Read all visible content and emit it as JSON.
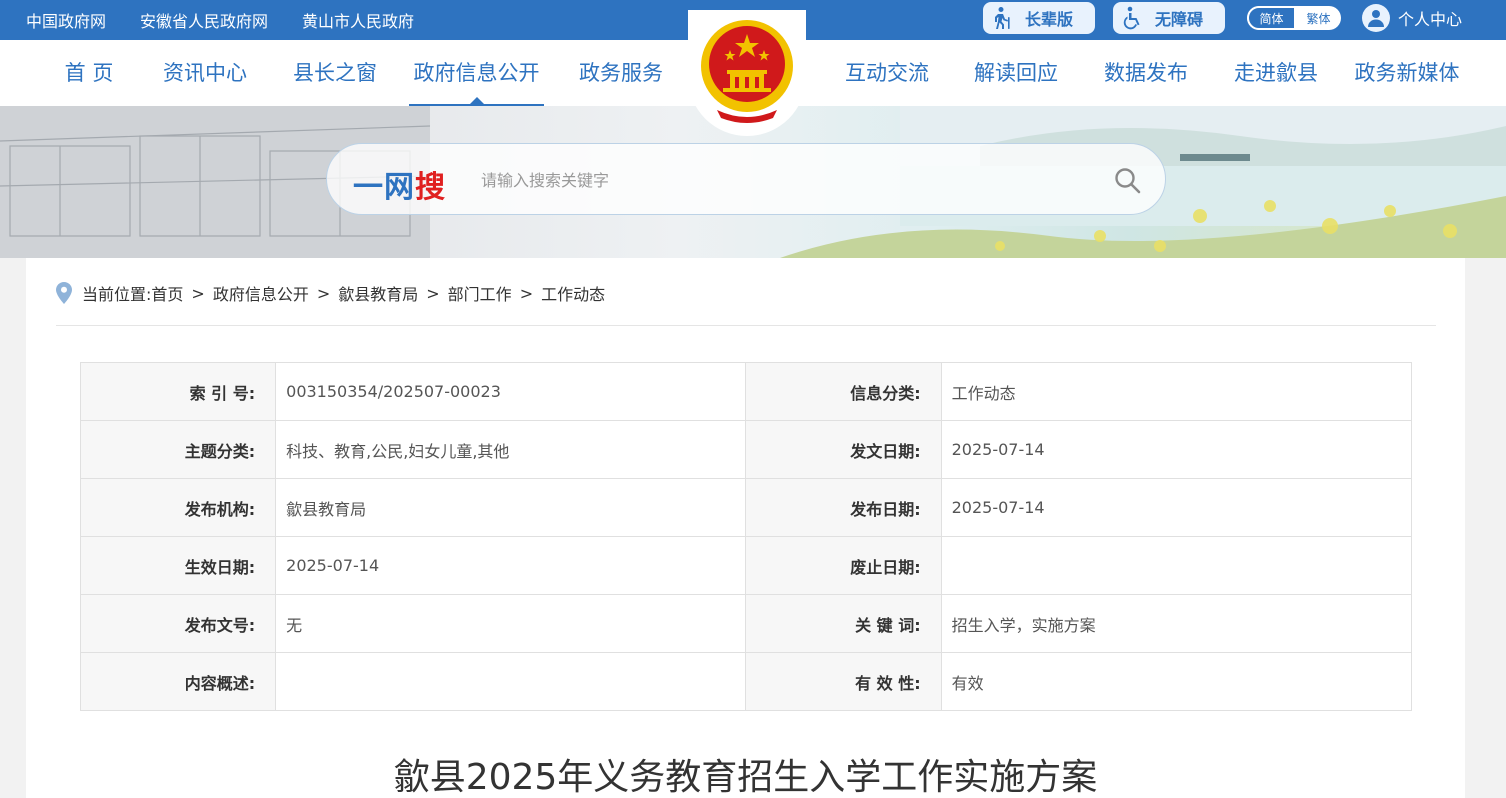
{
  "topbar": {
    "links": [
      "中国政府网",
      "安徽省人民政府网",
      "黄山市人民政府"
    ],
    "elder_label": "长辈版",
    "access_label": "无障碍",
    "lang_simplified": "简体",
    "lang_traditional": "繁体",
    "user_label": "个人中心"
  },
  "nav": {
    "items": [
      "首 页",
      "资讯中心",
      "县长之窗",
      "政府信息公开",
      "政务服务",
      "互动交流",
      "解读回应",
      "数据发布",
      "走进歙县",
      "政务新媒体"
    ],
    "active": "政府信息公开"
  },
  "search": {
    "logo_part1": "一网",
    "logo_part2": "搜",
    "placeholder": "请输入搜索关键字"
  },
  "breadcrumb": {
    "prefix": "当前位置:",
    "items": [
      "首页",
      "政府信息公开",
      "歙县教育局",
      "部门工作",
      "工作动态"
    ]
  },
  "meta": {
    "rows": [
      [
        {
          "label": "索 引 号:",
          "value": "003150354/202507-00023"
        },
        {
          "label": "信息分类:",
          "value": "工作动态"
        }
      ],
      [
        {
          "label": "主题分类:",
          "value": "科技、教育,公民,妇女儿童,其他"
        },
        {
          "label": "发文日期:",
          "value": "2025-07-14"
        }
      ],
      [
        {
          "label": "发布机构:",
          "value": "歙县教育局"
        },
        {
          "label": "发布日期:",
          "value": "2025-07-14"
        }
      ],
      [
        {
          "label": "生效日期:",
          "value": "2025-07-14"
        },
        {
          "label": "废止日期:",
          "value": ""
        }
      ],
      [
        {
          "label": "发布文号:",
          "value": "无"
        },
        {
          "label": "关 键 词:",
          "value": "招生入学，实施方案"
        }
      ],
      [
        {
          "label": "内容概述:",
          "value": ""
        },
        {
          "label": "有 效 性:",
          "value": "有效"
        }
      ]
    ]
  },
  "article": {
    "title": "歙县2025年义务教育招生入学工作实施方案"
  },
  "colors": {
    "brand_blue": "#2e73c0",
    "search_red": "#e02020",
    "emblem_red": "#d0191b",
    "emblem_gold": "#f2c200"
  }
}
